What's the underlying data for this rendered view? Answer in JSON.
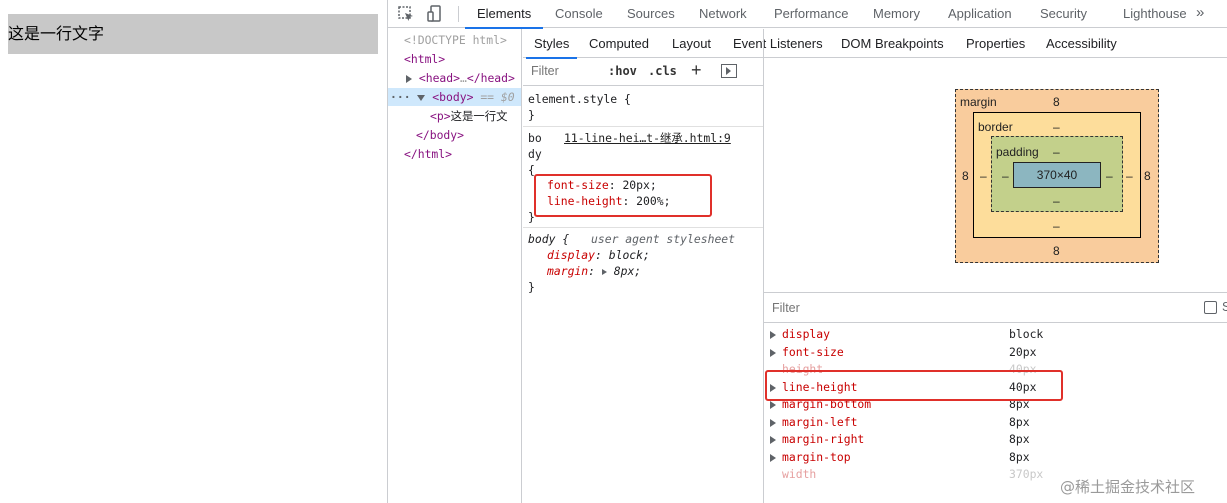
{
  "preview": {
    "paragraph_text": "这是一行文字"
  },
  "toolbar": {
    "tabs": [
      "Elements",
      "Console",
      "Sources",
      "Network",
      "Performance",
      "Memory",
      "Application",
      "Security",
      "Lighthouse"
    ],
    "active_tab": "Elements",
    "more": "»"
  },
  "tree": {
    "doctype": "<!DOCTYPE html>",
    "html_open": "<html>",
    "head": "<head>",
    "head_ellipsis": "…",
    "head_close": "</head>",
    "body_open": "<body>",
    "selected_marker": "== $0",
    "p_open": "<p>",
    "p_text": "这是一行文",
    "body_close": "</body>",
    "html_close": "</html>",
    "dots": "···"
  },
  "subtabs": [
    "Styles",
    "Computed",
    "Layout",
    "Event Listeners",
    "DOM Breakpoints",
    "Properties",
    "Accessibility"
  ],
  "styles": {
    "filter_placeholder": "Filter",
    "hov": ":hov",
    "cls": ".cls",
    "plus": "+",
    "element_style_open": "element.style {",
    "close_brace": "}",
    "rule1_selector_a": "bo",
    "rule1_selector_b": "dy",
    "rule1_source": "11-line-hei…t-继承.html:9",
    "rule1_open": "{",
    "rule1_props": [
      {
        "name": "font-size",
        "value": "20px;"
      },
      {
        "name": "line-height",
        "value": "200%;"
      }
    ],
    "rule2_selector": "body {",
    "rule2_source": "user agent stylesheet",
    "rule2_props": [
      {
        "name": "display",
        "value": "block;"
      },
      {
        "name": "margin",
        "value": "8px;"
      }
    ]
  },
  "boxmodel": {
    "margin_label": "margin",
    "border_label": "border",
    "padding_label": "padding",
    "margin_top": "8",
    "margin_bottom": "8",
    "margin_left": "8",
    "margin_right": "8",
    "border_top": "–",
    "border_bottom": "–",
    "border_left": "–",
    "border_right": "–",
    "padding_top": "–",
    "padding_bottom": "–",
    "padding_left": "–",
    "padding_right": "–",
    "content": "370×40"
  },
  "computed": {
    "filter_placeholder": "Filter",
    "show_all_label": "S",
    "rows": [
      {
        "name": "display",
        "value": "block"
      },
      {
        "name": "font-size",
        "value": "20px"
      },
      {
        "name": "height",
        "value": "40px"
      },
      {
        "name": "line-height",
        "value": "40px"
      },
      {
        "name": "margin-bottom",
        "value": "8px"
      },
      {
        "name": "margin-left",
        "value": "8px"
      },
      {
        "name": "margin-right",
        "value": "8px"
      },
      {
        "name": "margin-top",
        "value": "8px"
      },
      {
        "name": "width",
        "value": "370px"
      }
    ]
  },
  "watermark": "@稀土掘金技术社区",
  "colors": {
    "accent": "#1a73e8",
    "highlight_box": "#e0302a",
    "selected_row": "#cfe8fc"
  }
}
